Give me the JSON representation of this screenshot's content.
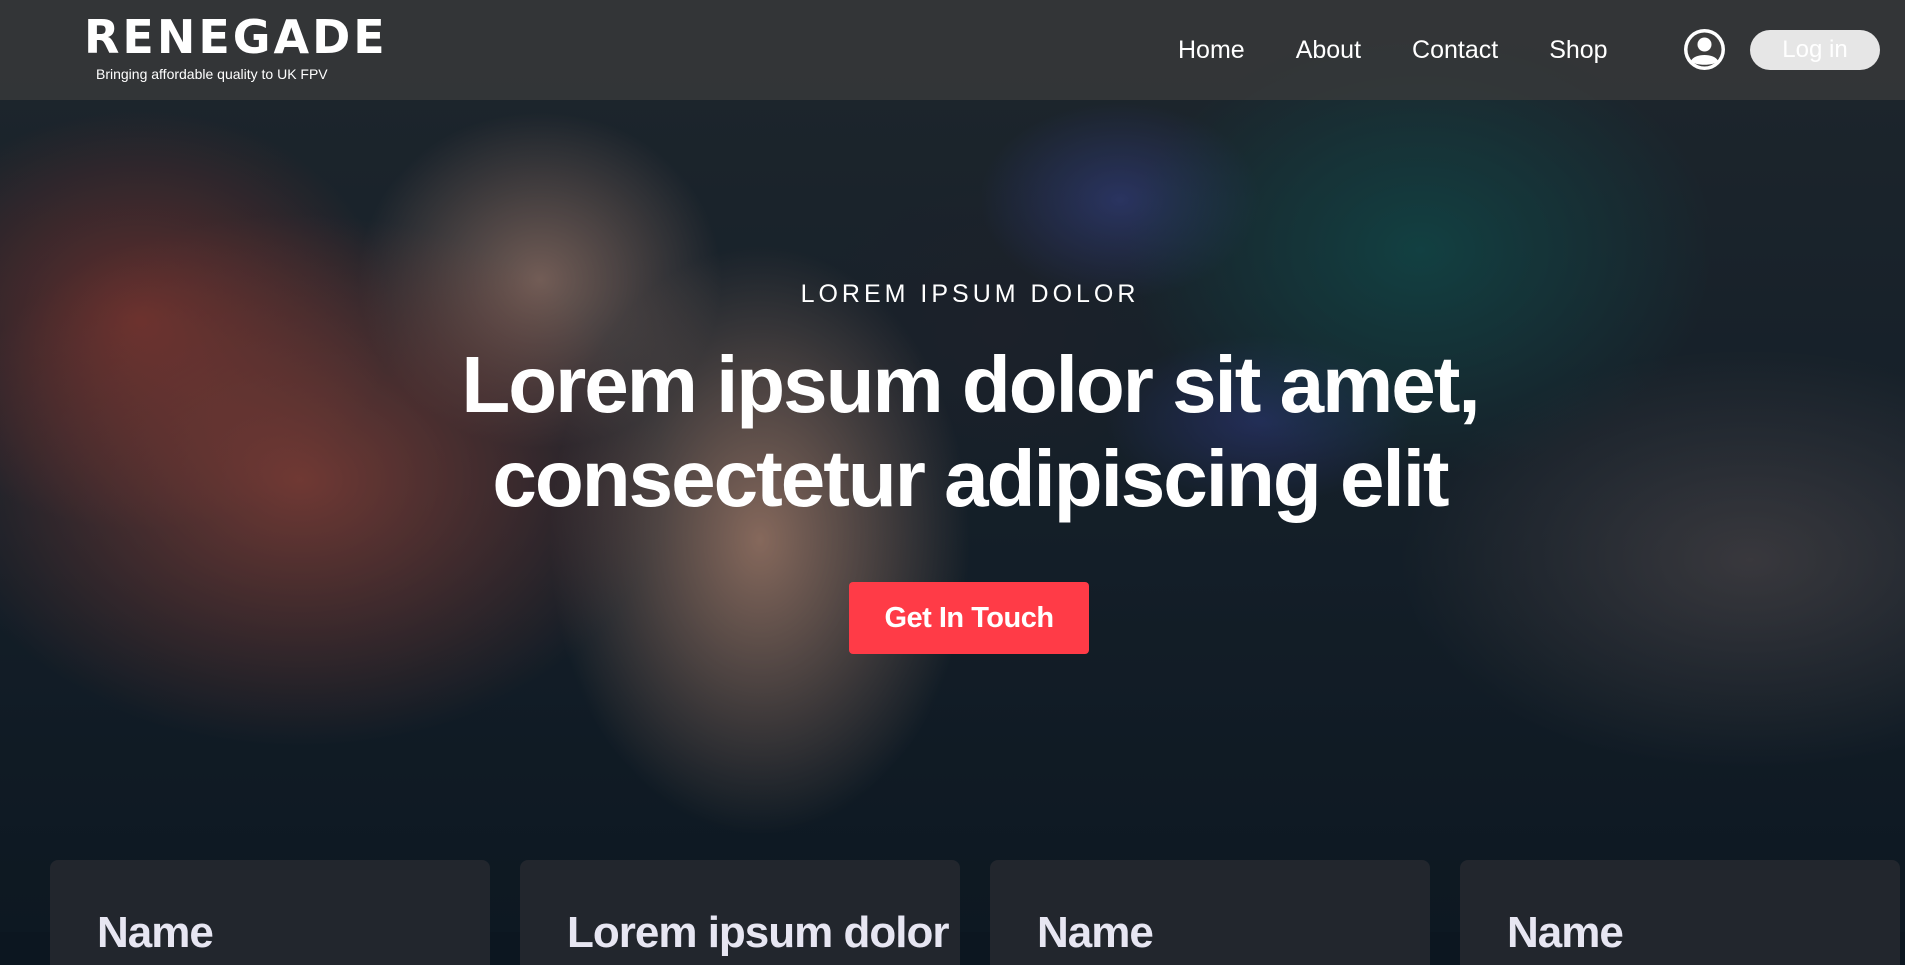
{
  "header": {
    "logo_text": "RENEGADE",
    "tagline": "Bringing affordable quality to UK FPV",
    "nav": [
      {
        "label": "Home"
      },
      {
        "label": "About"
      },
      {
        "label": "Contact"
      },
      {
        "label": "Shop"
      }
    ],
    "account_icon": "account-circle-icon",
    "login_label": "Log in"
  },
  "hero": {
    "eyebrow": "LOREM IPSUM DOLOR",
    "headline_line1": "Lorem ipsum dolor sit amet,",
    "headline_line2": "consectetur adipiscing elit",
    "cta_label": "Get In Touch"
  },
  "cards": [
    {
      "title": "Name"
    },
    {
      "title": "Lorem ipsum dolor"
    },
    {
      "title": "Name"
    },
    {
      "title": "Name"
    }
  ],
  "colors": {
    "cta": "#ff3b47",
    "card_bg": "#22262d",
    "header_bg": "rgba(60,60,60,0.72)",
    "card_title": "#e7e6f2"
  }
}
